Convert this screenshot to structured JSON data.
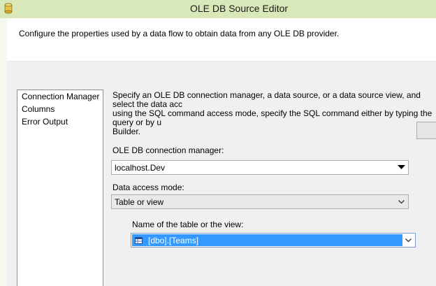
{
  "window": {
    "title": "OLE DB Source Editor"
  },
  "header": {
    "description": "Configure the properties used by a data flow to obtain data from any OLE DB provider."
  },
  "nav": {
    "items": [
      {
        "label": "Connection Manager"
      },
      {
        "label": "Columns"
      },
      {
        "label": "Error Output"
      }
    ]
  },
  "main": {
    "intro": "Specify an OLE DB connection manager, a data source, or a data source view, and select the data acc\nusing the SQL command access mode, specify the SQL command either by typing the query or by u\nBuilder.",
    "connection_label": "OLE DB connection manager:",
    "connection_value": "localhost.Dev",
    "access_mode_label": "Data access mode:",
    "access_mode_value": "Table or view",
    "table_label": "Name of the table or the view:",
    "table_value": "[dbo].[Teams]"
  },
  "icons": {
    "app": "ssis-source-icon",
    "dropdown": "chevron-down-icon",
    "table": "table-icon"
  },
  "colors": {
    "frame": "#d8e8b8",
    "selection": "#3399ff"
  }
}
